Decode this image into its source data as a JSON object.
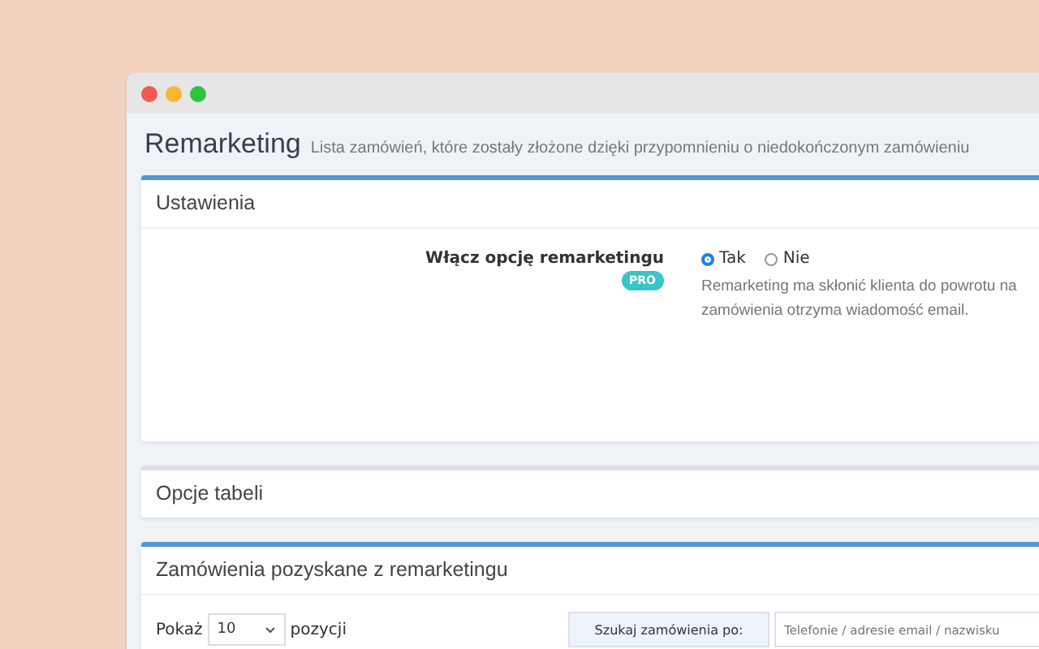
{
  "window": {
    "title": "Remarketing",
    "subtitle": "Lista zamówień, które zostały złożone dzięki przypomnieniu o niedokończonym zamówieniu"
  },
  "settings": {
    "heading": "Ustawienia",
    "option_label": "Włącz opcję remarketingu",
    "badge": "PRO",
    "choices": [
      {
        "label": "Tak",
        "selected": true
      },
      {
        "label": "Nie",
        "selected": false
      }
    ],
    "description": [
      "Remarketing ma skłonić klienta do powrotu na",
      "zamówienia otrzyma wiadomość email."
    ]
  },
  "table_options": {
    "heading": "Opcje tabeli"
  },
  "orders": {
    "heading": "Zamówienia pozyskane z remarketingu",
    "show_label": "Pokaż",
    "page_size": "10",
    "entries_label": "pozycji",
    "search_label": "Szukaj zamówienia po:",
    "search_placeholder": "Telefonie / adresie email / nazwisku"
  }
}
